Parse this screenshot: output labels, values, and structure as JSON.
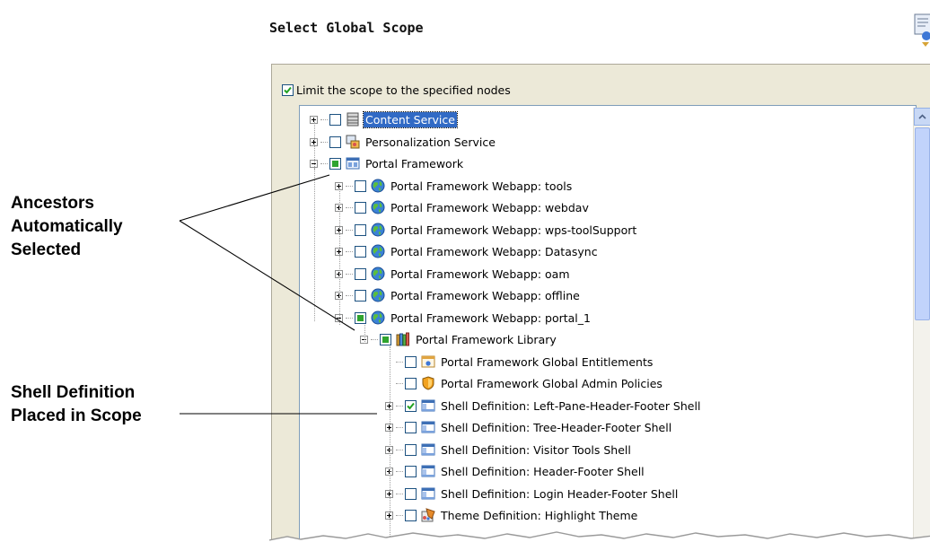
{
  "header": {
    "title": "Select Global Scope"
  },
  "limit_scope": {
    "label": "Limit the scope to the specified nodes",
    "checked": true
  },
  "tree": {
    "nodes": [
      {
        "label": "Content Service",
        "icon": "database-icon",
        "expander": "plus",
        "check": "unchecked",
        "selected": true
      },
      {
        "label": "Personalization Service",
        "icon": "personalization-service-icon",
        "expander": "plus",
        "check": "unchecked"
      },
      {
        "label": "Portal Framework",
        "icon": "portal-framework-icon",
        "expander": "minus",
        "check": "partial"
      },
      {
        "label": "Portal Framework Webapp: tools",
        "icon": "globe-icon",
        "expander": "plus",
        "check": "unchecked"
      },
      {
        "label": "Portal Framework Webapp: webdav",
        "icon": "globe-icon",
        "expander": "plus",
        "check": "unchecked"
      },
      {
        "label": "Portal Framework Webapp: wps-toolSupport",
        "icon": "globe-icon",
        "expander": "plus",
        "check": "unchecked"
      },
      {
        "label": "Portal Framework Webapp: Datasync",
        "icon": "globe-icon",
        "expander": "plus",
        "check": "unchecked"
      },
      {
        "label": "Portal Framework Webapp: oam",
        "icon": "globe-icon",
        "expander": "plus",
        "check": "unchecked"
      },
      {
        "label": "Portal Framework Webapp: offline",
        "icon": "globe-icon",
        "expander": "plus",
        "check": "unchecked"
      },
      {
        "label": "Portal Framework Webapp: portal_1",
        "icon": "globe-icon",
        "expander": "minus",
        "check": "partial"
      },
      {
        "label": "Portal Framework Library",
        "icon": "library-books-icon",
        "expander": "minus",
        "check": "partial"
      },
      {
        "label": "Portal Framework Global Entitlements",
        "icon": "entitlements-icon",
        "expander": "none",
        "check": "unchecked"
      },
      {
        "label": "Portal Framework Global Admin Policies",
        "icon": "shield-icon",
        "expander": "none",
        "check": "unchecked"
      },
      {
        "label": "Shell Definition: Left-Pane-Header-Footer Shell",
        "icon": "shell-definition-icon",
        "expander": "plus",
        "check": "checked"
      },
      {
        "label": "Shell Definition: Tree-Header-Footer Shell",
        "icon": "shell-definition-icon",
        "expander": "plus",
        "check": "unchecked"
      },
      {
        "label": "Shell Definition: Visitor Tools Shell",
        "icon": "shell-definition-icon",
        "expander": "plus",
        "check": "unchecked"
      },
      {
        "label": "Shell Definition: Header-Footer Shell",
        "icon": "shell-definition-icon",
        "expander": "plus",
        "check": "unchecked"
      },
      {
        "label": "Shell Definition: Login Header-Footer Shell",
        "icon": "shell-definition-icon",
        "expander": "plus",
        "check": "unchecked"
      },
      {
        "label": "Theme Definition: Highlight Theme",
        "icon": "theme-definition-icon",
        "expander": "plus",
        "check": "unchecked"
      }
    ]
  },
  "annotations": {
    "ancestors": [
      "Ancestors",
      "Automatically",
      "Selected"
    ],
    "shell": [
      "Shell Definition",
      "Placed in Scope"
    ]
  },
  "colors": {
    "selection": "#316ac5",
    "check_green": "#2fa42f",
    "panel_bg": "#ece9d8"
  }
}
